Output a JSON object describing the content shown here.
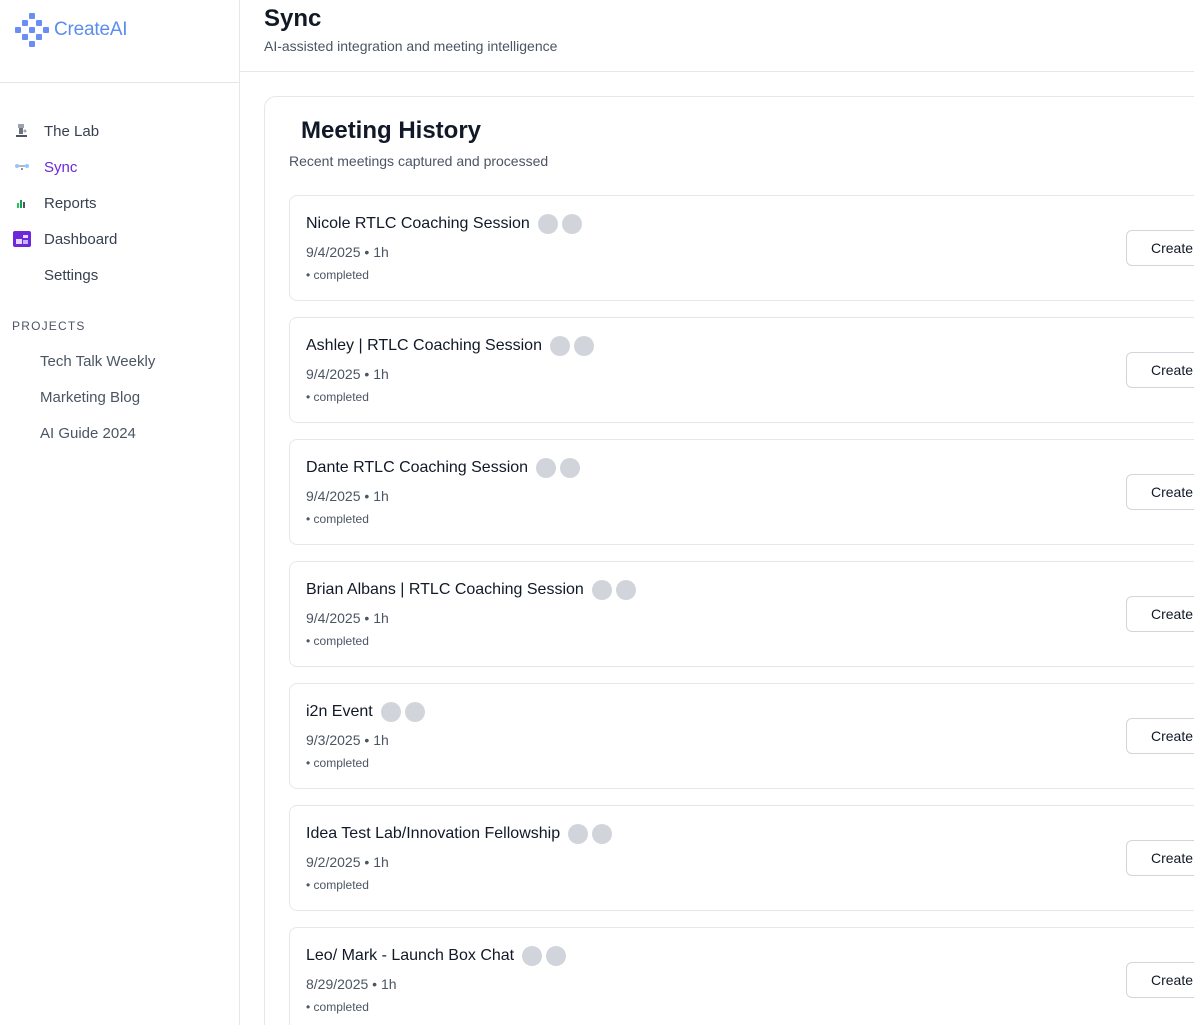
{
  "brand": {
    "name": "CreateAI",
    "accent": "#5b8def",
    "active_color": "#6d28d9"
  },
  "sidebar": {
    "nav": [
      {
        "label": "The Lab",
        "icon": "microscope-icon"
      },
      {
        "label": "Sync",
        "icon": "sync-icon",
        "active": true
      },
      {
        "label": "Reports",
        "icon": "chart-icon"
      },
      {
        "label": "Dashboard",
        "icon": "dashboard-icon"
      },
      {
        "label": "Settings",
        "icon": ""
      }
    ],
    "projects_title": "PROJECTS",
    "projects": [
      {
        "label": "Tech Talk Weekly"
      },
      {
        "label": "Marketing Blog"
      },
      {
        "label": "AI Guide 2024"
      }
    ]
  },
  "header": {
    "title": "Sync",
    "subtitle": "AI-assisted integration and meeting intelligence"
  },
  "history": {
    "title": "Meeting History",
    "subtitle": "Recent meetings captured and processed",
    "meetings": [
      {
        "title": "Nicole RTLC Coaching Session",
        "date": "9/4/2025",
        "duration": "1h",
        "status": "• completed",
        "action": "Create"
      },
      {
        "title": "Ashley | RTLC Coaching Session",
        "date": "9/4/2025",
        "duration": "1h",
        "status": "• completed",
        "action": "Create"
      },
      {
        "title": "Dante RTLC Coaching Session",
        "date": "9/4/2025",
        "duration": "1h",
        "status": "• completed",
        "action": "Create"
      },
      {
        "title": "Brian Albans | RTLC Coaching Session",
        "date": "9/4/2025",
        "duration": "1h",
        "status": "• completed",
        "action": "Create"
      },
      {
        "title": "i2n Event",
        "date": "9/3/2025",
        "duration": "1h",
        "status": "• completed",
        "action": "Create"
      },
      {
        "title": "Idea Test Lab/Innovation Fellowship",
        "date": "9/2/2025",
        "duration": "1h",
        "status": "• completed",
        "action": "Create"
      },
      {
        "title": "Leo/ Mark - Launch Box Chat",
        "date": "8/29/2025",
        "duration": "1h",
        "status": "• completed",
        "action": "Create"
      }
    ]
  }
}
